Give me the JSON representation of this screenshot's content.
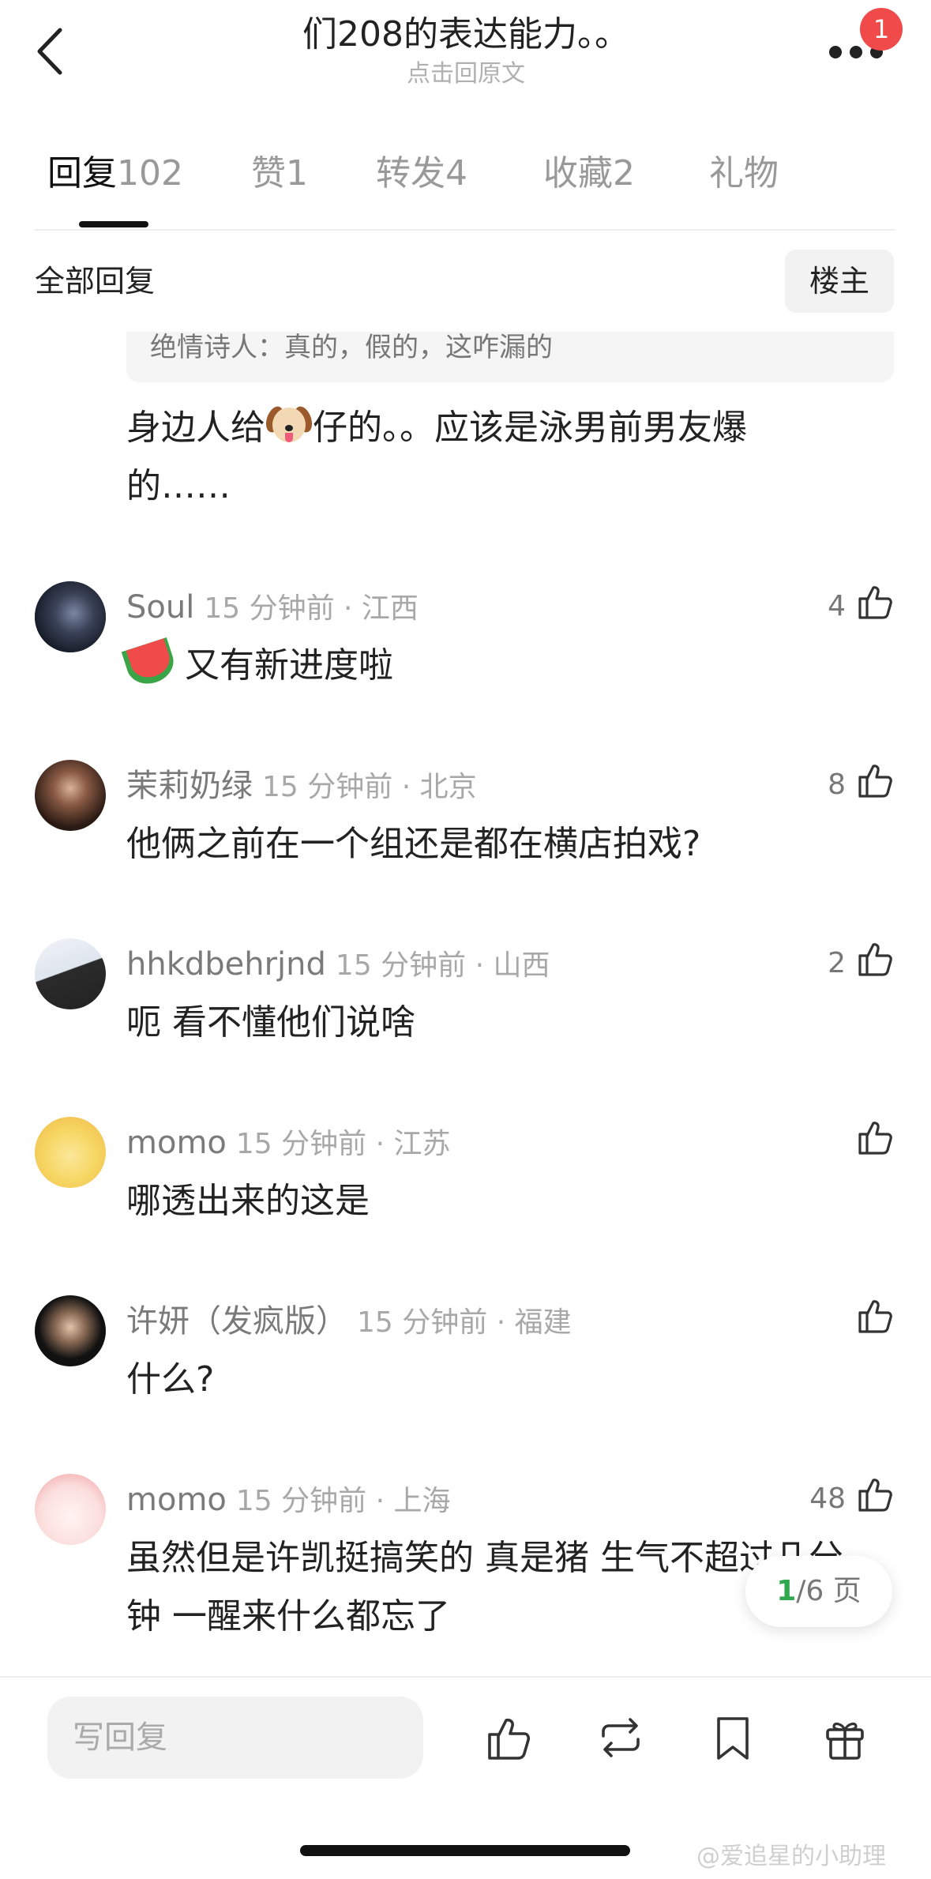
{
  "header": {
    "title": "们208的表达能力。。",
    "subtitle": "点击回原文",
    "badge_count": "1",
    "back_icon": "chevron-left-icon",
    "more_icon": "more-dots-icon"
  },
  "tabs": [
    {
      "label": "回复",
      "count": "102",
      "active": true
    },
    {
      "label": "赞",
      "count": "1"
    },
    {
      "label": "转发",
      "count": "4"
    },
    {
      "label": "收藏",
      "count": "2"
    },
    {
      "label": "礼物",
      "count": ""
    }
  ],
  "filter": {
    "label": "全部回复",
    "op_button": "楼主"
  },
  "quoted_comment": "绝情诗人：真的，假的，这咋漏的",
  "first_comment": {
    "text_before": "身边人给",
    "emoji": "dog-face-emoji",
    "text_after": "仔的。。应该是泳男前男友爆的……"
  },
  "comments": [
    {
      "name": "Soul",
      "time": "15 分钟前 · 江西",
      "text": "又有新进度啦",
      "emoji": "watermelon-emoji",
      "likes": "4",
      "avatar_colors": [
        "#1d2230",
        "#5b6a8a"
      ]
    },
    {
      "name": "茉莉奶绿",
      "time": "15 分钟前 · 北京",
      "text": "他俩之前在一个组还是都在横店拍戏?",
      "likes": "8",
      "avatar_colors": [
        "#2a1a14",
        "#c99a7e"
      ]
    },
    {
      "name": "hhkdbehrjnd",
      "time": "15 分钟前 · 山西",
      "text": "呃 看不懂他们说啥",
      "likes": "2",
      "avatar_colors": [
        "#e9eef5",
        "#222222"
      ]
    },
    {
      "name": "momo",
      "time": "15 分钟前 · 江苏",
      "text": "哪透出来的这是",
      "likes": "",
      "avatar_colors": [
        "#f6e28a",
        "#f4a640"
      ]
    },
    {
      "name": "许妍（发疯版）",
      "time": "15 分钟前 · 福建",
      "text": "什么?",
      "likes": "",
      "avatar_colors": [
        "#111111",
        "#d8b49a"
      ]
    },
    {
      "name": "momo",
      "time": "15 分钟前 · 上海",
      "text": "虽然但是许凯挺搞笑的 真是猪 生气不超过几分钟 一醒来什么都忘了",
      "likes": "48",
      "avatar_colors": [
        "#fbe3e3",
        "#f29a9a"
      ]
    }
  ],
  "pagination": {
    "current": "1",
    "total": "/6 页"
  },
  "bottom_bar": {
    "reply_placeholder": "写回复",
    "icons": [
      "thumbs-up-icon",
      "repost-icon",
      "bookmark-icon",
      "gift-icon"
    ]
  },
  "watermark": "@爱追星的小助理",
  "colors": {
    "accent_green": "#2fa84f",
    "badge_red": "#f04a4a"
  }
}
